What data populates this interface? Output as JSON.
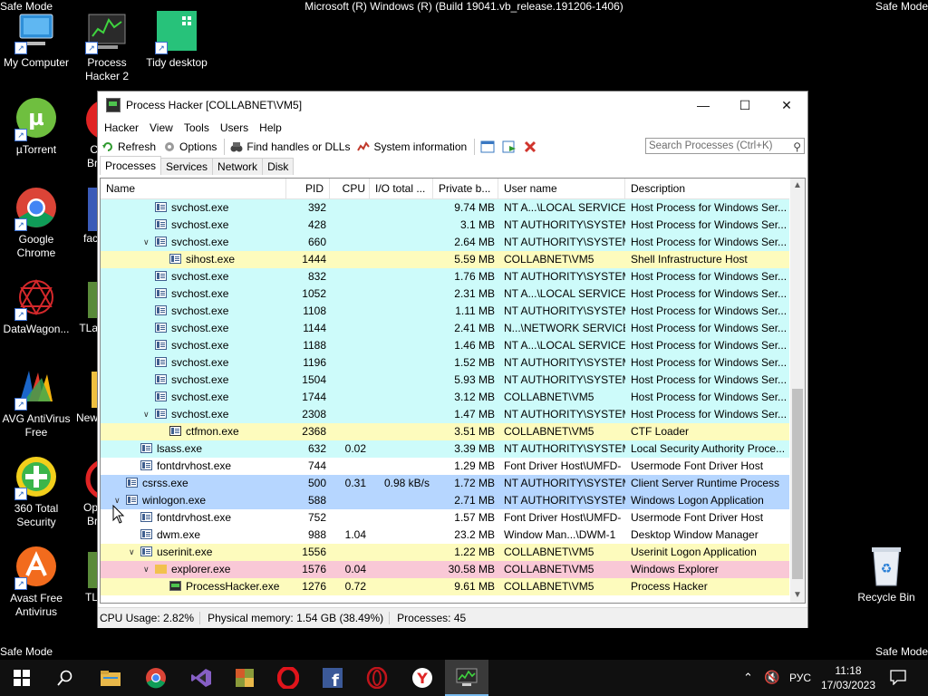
{
  "desktop": {
    "safe_mode": "Safe Mode",
    "system_title": "Microsoft (R) Windows (R) (Build 19041.vb_release.191206-1406)",
    "icons": [
      {
        "label": "My Computer",
        "icon": "computer-icon"
      },
      {
        "label": "Process Hacker 2",
        "icon": "process-hacker-icon"
      },
      {
        "label": "Tidy desktop",
        "icon": "tidy-desktop-icon"
      },
      {
        "label": "µTorrent",
        "icon": "utorrent-icon"
      },
      {
        "label": "Google Chrome",
        "icon": "chrome-icon"
      },
      {
        "label": "DataWagon...",
        "icon": "datawagon-icon"
      },
      {
        "label": "AVG AntiVirus Free",
        "icon": "avg-icon"
      },
      {
        "label": "360 Total Security",
        "icon": "360-security-icon"
      },
      {
        "label": "Avast Free Antivirus",
        "icon": "avast-icon"
      },
      {
        "label": "Recycle Bin",
        "icon": "recycle-bin-icon"
      }
    ],
    "partial_labels": [
      "C",
      "Br",
      "fac",
      "TLa",
      "New",
      "Op",
      "Br",
      "TL"
    ]
  },
  "window": {
    "title": "Process Hacker [COLLABNET\\VM5]",
    "menu": [
      "Hacker",
      "View",
      "Tools",
      "Users",
      "Help"
    ],
    "toolbar": {
      "refresh": "Refresh",
      "options": "Options",
      "find_handles": "Find handles or DLLs",
      "system_info": "System information"
    },
    "search_placeholder": "Search Processes (Ctrl+K)",
    "tabs": [
      "Processes",
      "Services",
      "Network",
      "Disk"
    ],
    "active_tab": "Processes",
    "columns": [
      "Name",
      "PID",
      "CPU",
      "I/O total ...",
      "Private b...",
      "User name",
      "Description"
    ],
    "rows": [
      {
        "name": "svchost.exe",
        "pid": "392",
        "cpu": "",
        "io": "",
        "priv": "9.74 MB",
        "user": "NT A...\\LOCAL SERVICE",
        "desc": "Host Process for Windows Ser...",
        "indent": 3,
        "bg": "#cdfbfa",
        "expander": ""
      },
      {
        "name": "svchost.exe",
        "pid": "428",
        "cpu": "",
        "io": "",
        "priv": "3.1 MB",
        "user": "NT AUTHORITY\\SYSTEM",
        "desc": "Host Process for Windows Ser...",
        "indent": 3,
        "bg": "#cdfbfa",
        "expander": ""
      },
      {
        "name": "svchost.exe",
        "pid": "660",
        "cpu": "",
        "io": "",
        "priv": "2.64 MB",
        "user": "NT AUTHORITY\\SYSTEM",
        "desc": "Host Process for Windows Ser...",
        "indent": 3,
        "bg": "#cdfbfa",
        "expander": "v"
      },
      {
        "name": "sihost.exe",
        "pid": "1444",
        "cpu": "",
        "io": "",
        "priv": "5.59 MB",
        "user": "COLLABNET\\VM5",
        "desc": "Shell Infrastructure Host",
        "indent": 4,
        "bg": "#fdfbbd",
        "expander": ""
      },
      {
        "name": "svchost.exe",
        "pid": "832",
        "cpu": "",
        "io": "",
        "priv": "1.76 MB",
        "user": "NT AUTHORITY\\SYSTEM",
        "desc": "Host Process for Windows Ser...",
        "indent": 3,
        "bg": "#cdfbfa",
        "expander": ""
      },
      {
        "name": "svchost.exe",
        "pid": "1052",
        "cpu": "",
        "io": "",
        "priv": "2.31 MB",
        "user": "NT A...\\LOCAL SERVICE",
        "desc": "Host Process for Windows Ser...",
        "indent": 3,
        "bg": "#cdfbfa",
        "expander": ""
      },
      {
        "name": "svchost.exe",
        "pid": "1108",
        "cpu": "",
        "io": "",
        "priv": "1.11 MB",
        "user": "NT AUTHORITY\\SYSTEM",
        "desc": "Host Process for Windows Ser...",
        "indent": 3,
        "bg": "#cdfbfa",
        "expander": ""
      },
      {
        "name": "svchost.exe",
        "pid": "1144",
        "cpu": "",
        "io": "",
        "priv": "2.41 MB",
        "user": "N...\\NETWORK SERVICE",
        "desc": "Host Process for Windows Ser...",
        "indent": 3,
        "bg": "#cdfbfa",
        "expander": ""
      },
      {
        "name": "svchost.exe",
        "pid": "1188",
        "cpu": "",
        "io": "",
        "priv": "1.46 MB",
        "user": "NT A...\\LOCAL SERVICE",
        "desc": "Host Process for Windows Ser...",
        "indent": 3,
        "bg": "#cdfbfa",
        "expander": ""
      },
      {
        "name": "svchost.exe",
        "pid": "1196",
        "cpu": "",
        "io": "",
        "priv": "1.52 MB",
        "user": "NT AUTHORITY\\SYSTEM",
        "desc": "Host Process for Windows Ser...",
        "indent": 3,
        "bg": "#cdfbfa",
        "expander": ""
      },
      {
        "name": "svchost.exe",
        "pid": "1504",
        "cpu": "",
        "io": "",
        "priv": "5.93 MB",
        "user": "NT AUTHORITY\\SYSTEM",
        "desc": "Host Process for Windows Ser...",
        "indent": 3,
        "bg": "#cdfbfa",
        "expander": ""
      },
      {
        "name": "svchost.exe",
        "pid": "1744",
        "cpu": "",
        "io": "",
        "priv": "3.12 MB",
        "user": "COLLABNET\\VM5",
        "desc": "Host Process for Windows Ser...",
        "indent": 3,
        "bg": "#cdfbfa",
        "expander": ""
      },
      {
        "name": "svchost.exe",
        "pid": "2308",
        "cpu": "",
        "io": "",
        "priv": "1.47 MB",
        "user": "NT AUTHORITY\\SYSTEM",
        "desc": "Host Process for Windows Ser...",
        "indent": 3,
        "bg": "#cdfbfa",
        "expander": "v"
      },
      {
        "name": "ctfmon.exe",
        "pid": "2368",
        "cpu": "",
        "io": "",
        "priv": "3.51 MB",
        "user": "COLLABNET\\VM5",
        "desc": "CTF Loader",
        "indent": 4,
        "bg": "#fdfbbd",
        "expander": "",
        "icon": "ctf"
      },
      {
        "name": "lsass.exe",
        "pid": "632",
        "cpu": "0.02",
        "io": "",
        "priv": "3.39 MB",
        "user": "NT AUTHORITY\\SYSTEM",
        "desc": "Local Security Authority Proce...",
        "indent": 2,
        "bg": "#cdfbfa",
        "expander": ""
      },
      {
        "name": "fontdrvhost.exe",
        "pid": "744",
        "cpu": "",
        "io": "",
        "priv": "1.29 MB",
        "user": "Font Driver Host\\UMFD-",
        "desc": "Usermode Font Driver Host",
        "indent": 2,
        "bg": "#ffffff",
        "expander": ""
      },
      {
        "name": "csrss.exe",
        "pid": "500",
        "cpu": "0.31",
        "io": "0.98 kB/s",
        "priv": "1.72 MB",
        "user": "NT AUTHORITY\\SYSTEM",
        "desc": "Client Server Runtime Process",
        "indent": 1,
        "bg": "#b6d6ff",
        "expander": ""
      },
      {
        "name": "winlogon.exe",
        "pid": "588",
        "cpu": "",
        "io": "",
        "priv": "2.71 MB",
        "user": "NT AUTHORITY\\SYSTEM",
        "desc": "Windows Logon Application",
        "indent": 1,
        "bg": "#b6d6ff",
        "expander": "v"
      },
      {
        "name": "fontdrvhost.exe",
        "pid": "752",
        "cpu": "",
        "io": "",
        "priv": "1.57 MB",
        "user": "Font Driver Host\\UMFD-",
        "desc": "Usermode Font Driver Host",
        "indent": 2,
        "bg": "#ffffff",
        "expander": ""
      },
      {
        "name": "dwm.exe",
        "pid": "988",
        "cpu": "1.04",
        "io": "",
        "priv": "23.2 MB",
        "user": "Window Man...\\DWM-1",
        "desc": "Desktop Window Manager",
        "indent": 2,
        "bg": "#ffffff",
        "expander": ""
      },
      {
        "name": "userinit.exe",
        "pid": "1556",
        "cpu": "",
        "io": "",
        "priv": "1.22 MB",
        "user": "COLLABNET\\VM5",
        "desc": "Userinit Logon Application",
        "indent": 2,
        "bg": "#fdfbbd",
        "expander": "v"
      },
      {
        "name": "explorer.exe",
        "pid": "1576",
        "cpu": "0.04",
        "io": "",
        "priv": "30.58 MB",
        "user": "COLLABNET\\VM5",
        "desc": "Windows Explorer",
        "indent": 3,
        "bg": "#f9c8d6",
        "expander": "v",
        "icon": "folder"
      },
      {
        "name": "ProcessHacker.exe",
        "pid": "1276",
        "cpu": "0.72",
        "io": "",
        "priv": "9.61 MB",
        "user": "COLLABNET\\VM5",
        "desc": "Process Hacker",
        "indent": 4,
        "bg": "#fdfbbd",
        "expander": "",
        "icon": "ph"
      }
    ],
    "status": {
      "cpu": "CPU Usage: 2.82%",
      "memory": "Physical memory: 1.54 GB (38.49%)",
      "processes": "Processes: 45"
    }
  },
  "taskbar": {
    "items": [
      "start-icon",
      "search-icon",
      "file-explorer-icon",
      "chrome-icon",
      "visual-studio-icon",
      "app-icon",
      "opera-icon",
      "facebook-icon",
      "opera-gx-icon",
      "yandex-icon",
      "process-hacker-icon"
    ],
    "language": "РУС",
    "time": "11:18",
    "date": "17/03/2023"
  }
}
